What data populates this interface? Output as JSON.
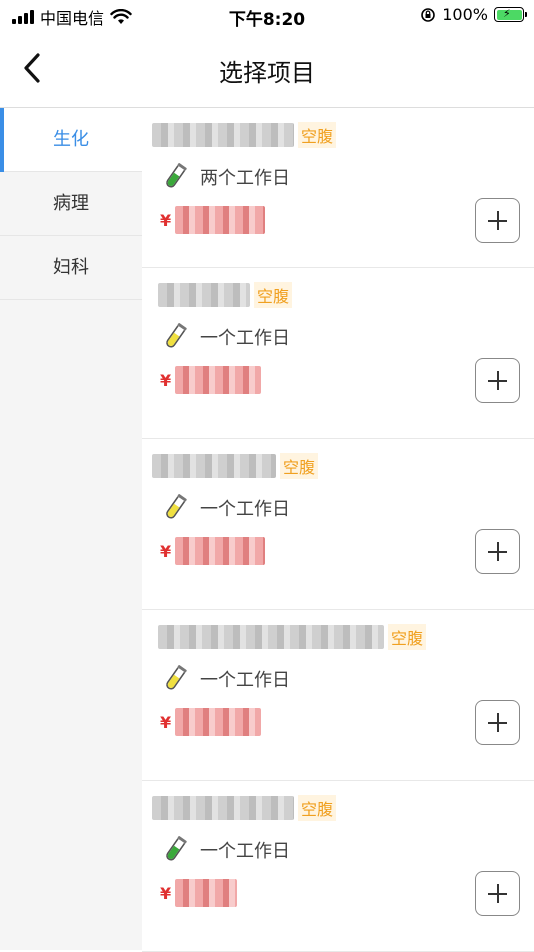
{
  "status_bar": {
    "carrier": "中国电信",
    "time": "下午8:20",
    "battery": "100%"
  },
  "nav": {
    "title": "选择项目"
  },
  "sidebar": {
    "items": [
      {
        "label": "生化",
        "active": true
      },
      {
        "label": "病理",
        "active": false
      },
      {
        "label": "妇科",
        "active": false
      }
    ]
  },
  "items": [
    {
      "tag": "空腹",
      "duration": "两个工作日",
      "tube_color": "green",
      "currency": "¥"
    },
    {
      "tag": "空腹",
      "duration": "一个工作日",
      "tube_color": "yellow",
      "currency": "¥"
    },
    {
      "tag": "空腹",
      "duration": "一个工作日",
      "tube_color": "yellow",
      "currency": "¥"
    },
    {
      "tag": "空腹",
      "duration": "一个工作日",
      "tube_color": "yellow",
      "currency": "¥"
    },
    {
      "tag": "空腹",
      "duration": "一个工作日",
      "tube_color": "green",
      "currency": "¥"
    }
  ],
  "colors": {
    "accent": "#3a8ee6",
    "tag": "#f0a020",
    "price": "#e03030",
    "tube_green": "#3aa83a",
    "tube_yellow": "#f0e040"
  }
}
